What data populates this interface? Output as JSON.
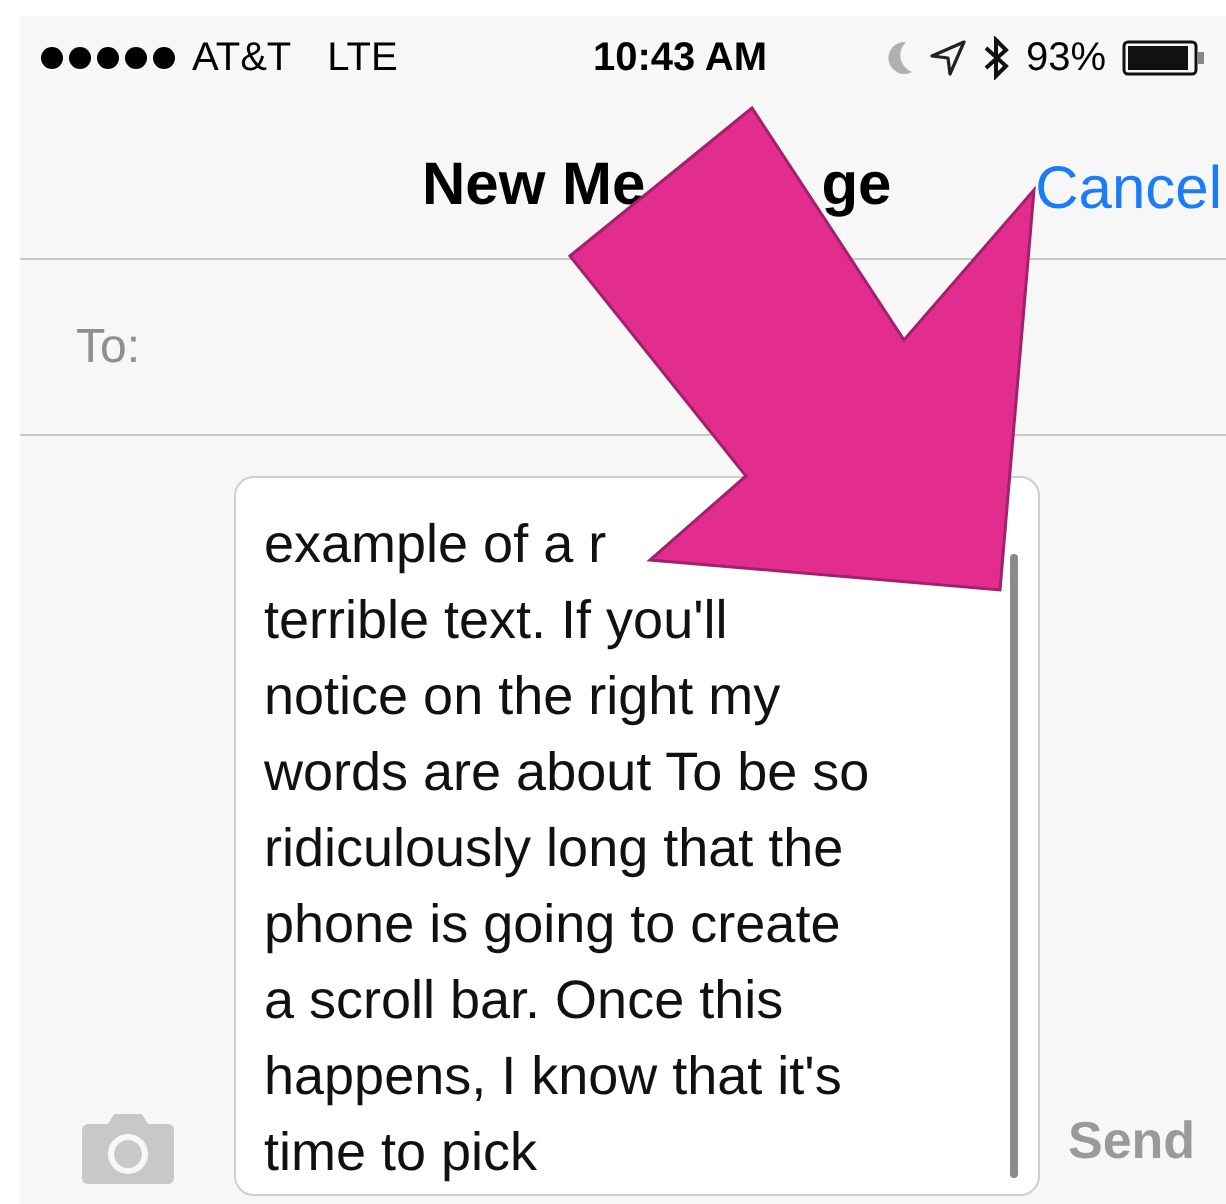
{
  "status_bar": {
    "carrier": "AT&T",
    "network": "LTE",
    "time": "10:43 AM",
    "battery": "93%"
  },
  "nav": {
    "title_parts": [
      "New Me",
      "ge"
    ],
    "cancel": "Cancel"
  },
  "to_field": {
    "label": "To:"
  },
  "composer": {
    "lines": [
      "example of a r",
      "terrible text. If you'll",
      "notice on the right my",
      "words are about To be so",
      "ridiculously long that the",
      "phone is going to create",
      "a scroll bar. Once this",
      "happens, I know that it's",
      "time to pick"
    ],
    "send": "Send"
  }
}
